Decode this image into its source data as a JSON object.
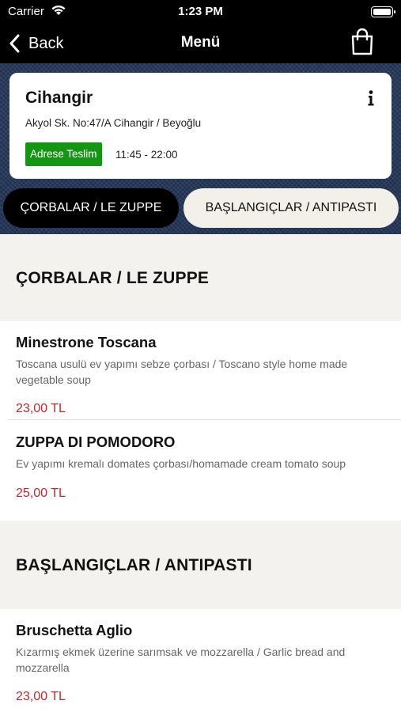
{
  "status_bar": {
    "carrier": "Carrier",
    "time": "1:23 PM"
  },
  "nav": {
    "back_label": "Back",
    "title": "Menü"
  },
  "restaurant": {
    "name": "Cihangir",
    "address": "Akyol Sk. No:47/A Cihangir / Beyoğlu",
    "delivery_badge": "Adrese Teslim",
    "hours": "11:45 - 22:00"
  },
  "tabs": [
    {
      "label": "ÇORBALAR / LE ZUPPE",
      "active": true
    },
    {
      "label": "BAŞLANGIÇLAR /  ANTIPASTI",
      "active": false
    }
  ],
  "sections": [
    {
      "title": "ÇORBALAR / LE ZUPPE",
      "items": [
        {
          "name": "Minestrone Toscana",
          "description": "Toscana usulü ev yapımı sebze çorbası / Toscano style home made vegetable soup",
          "price": "23,00 TL"
        },
        {
          "name": "ZUPPA DI POMODORO",
          "description": "Ev yapımı kremalı domates çorbası/homamade cream tomato soup",
          "price": "25,00 TL"
        }
      ]
    },
    {
      "title": "BAŞLANGIÇLAR /  ANTIPASTI",
      "items": [
        {
          "name": "Bruschetta Aglio",
          "description": "Kızarmış ekmek üzerine sarımsak ve mozzarella / Garlic bread and mozzarella",
          "price": "23,00 TL"
        }
      ]
    }
  ],
  "colors": {
    "accent_price": "#c0282d",
    "badge_green": "#149614",
    "header_bg": "#1e2f4c"
  },
  "icons": [
    "wifi-icon",
    "battery-icon",
    "back-chevron-icon",
    "shopping-bag-icon",
    "info-icon"
  ]
}
